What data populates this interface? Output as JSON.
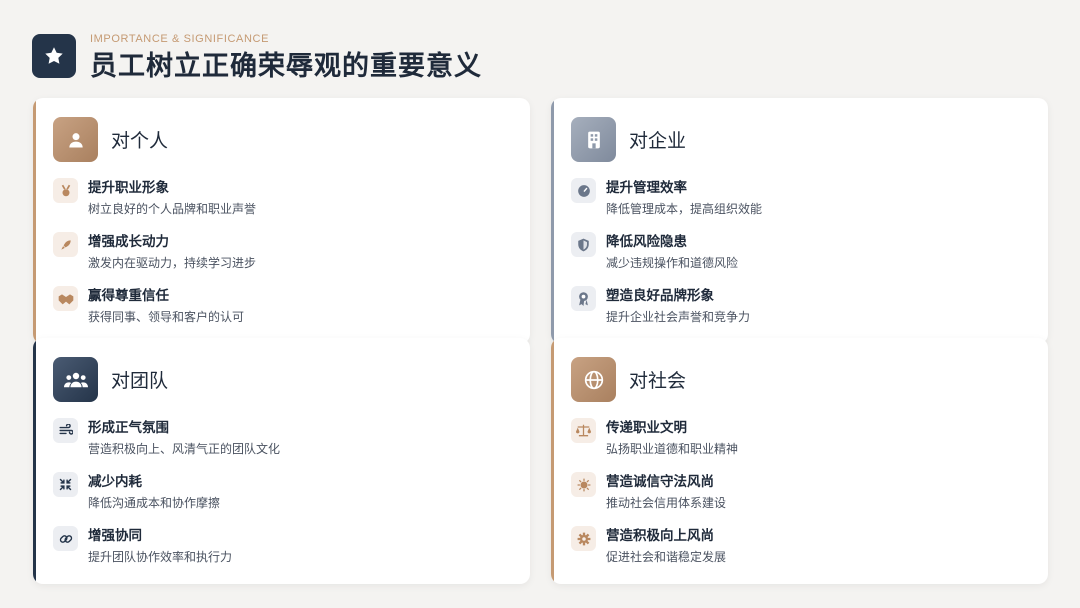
{
  "header": {
    "subtitle": "IMPORTANCE & SIGNIFICANCE",
    "title": "员工树立正确荣辱观的重要意义",
    "icon": "star-icon"
  },
  "colors": {
    "navy": "#243449",
    "tan": "#c59a73",
    "tan_light": "#f6ede6",
    "gray_light": "#eceef2"
  },
  "cards": [
    {
      "title": "对个人",
      "icon": "user-icon",
      "items": [
        {
          "icon": "medal-icon",
          "title": "提升职业形象",
          "desc": "树立良好的个人品牌和职业声誉"
        },
        {
          "icon": "rocket-icon",
          "title": "增强成长动力",
          "desc": "激发内在驱动力，持续学习进步"
        },
        {
          "icon": "handshake-icon",
          "title": "赢得尊重信任",
          "desc": "获得同事、领导和客户的认可"
        }
      ]
    },
    {
      "title": "对企业",
      "icon": "building-icon",
      "items": [
        {
          "icon": "gauge-icon",
          "title": "提升管理效率",
          "desc": "降低管理成本，提高组织效能"
        },
        {
          "icon": "shield-icon",
          "title": "降低风险隐患",
          "desc": "减少违规操作和道德风险"
        },
        {
          "icon": "award-icon",
          "title": "塑造良好品牌形象",
          "desc": "提升企业社会声誉和竞争力"
        }
      ]
    },
    {
      "title": "对团队",
      "icon": "users-icon",
      "items": [
        {
          "icon": "wind-icon",
          "title": "形成正气氛围",
          "desc": "营造积极向上、风清气正的团队文化"
        },
        {
          "icon": "compress-icon",
          "title": "减少内耗",
          "desc": "降低沟通成本和协作摩擦"
        },
        {
          "icon": "link-icon",
          "title": "增强协同",
          "desc": "提升团队协作效率和执行力"
        }
      ]
    },
    {
      "title": "对社会",
      "icon": "globe-icon",
      "items": [
        {
          "icon": "scale-icon",
          "title": "传递职业文明",
          "desc": "弘扬职业道德和职业精神"
        },
        {
          "icon": "sun-icon",
          "title": "营造诚信守法风尚",
          "desc": "推动社会信用体系建设"
        },
        {
          "icon": "gear-icon",
          "title": "营造积极向上风尚",
          "desc": "促进社会和谐稳定发展"
        }
      ]
    }
  ]
}
